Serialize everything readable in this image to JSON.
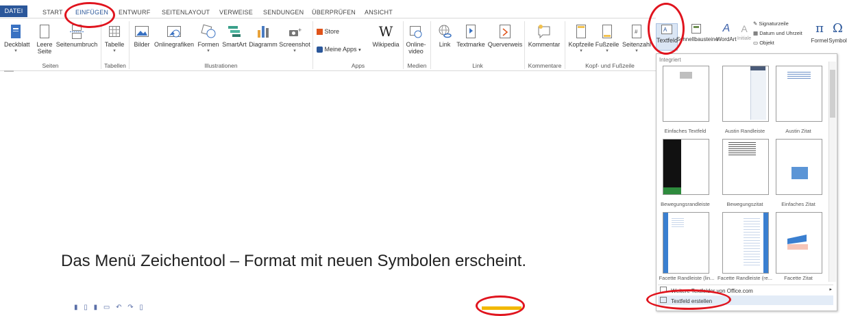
{
  "tabs": {
    "file": "DATEI",
    "start": "START",
    "insert": "EINFÜGEN",
    "design": "ENTWURF",
    "layout": "SEITENLAYOUT",
    "references": "VERWEISE",
    "mailings": "SENDUNGEN",
    "review": "ÜBERPRÜFEN",
    "view": "ANSICHT"
  },
  "ribbon": {
    "coverpage": "Deckblatt",
    "blank_page_1": "Leere",
    "blank_page_2": "Seite",
    "page_break": "Seitenumbruch",
    "table": "Tabelle",
    "pictures": "Bilder",
    "online_pictures": "Onlinegrafiken",
    "shapes": "Formen",
    "smartart": "SmartArt",
    "chart": "Diagramm",
    "screenshot": "Screenshot",
    "store": "Store",
    "my_apps": "Meine Apps",
    "wikipedia": "Wikipedia",
    "online_video_1": "Online-",
    "online_video_2": "video",
    "link": "Link",
    "bookmark": "Textmarke",
    "crossref": "Querverweis",
    "comment": "Kommentar",
    "header": "Kopfzeile",
    "footer": "Fußzeile",
    "page_number": "Seitenzahl",
    "textbox": "Textfeld",
    "quickparts": "Schnellbausteine",
    "wordart": "WordArt",
    "dropcap": "Initiale",
    "signature_line": "Signaturzeile",
    "date_time": "Datum und Uhrzeit",
    "object": "Objekt",
    "equation": "Formel",
    "symbol": "Symbol"
  },
  "groups": {
    "pages": "Seiten",
    "tables": "Tabellen",
    "illustrations": "Illustrationen",
    "apps": "Apps",
    "media": "Medien",
    "links": "Link",
    "comments": "Kommentare",
    "header_footer": "Kopf- und Fußzeile"
  },
  "gallery": {
    "heading": "Integriert",
    "items": [
      "Einfaches Textfeld",
      "Austin Randleiste",
      "Austin Zitat",
      "Bewegungsrandleiste",
      "Bewegungszitat",
      "Einfaches Zitat",
      "Facette Randleiste (lin...",
      "Facette Randleiste (re...",
      "Facette Zitat"
    ],
    "more_office": "Weitere Textfelder von Office.com",
    "draw_textbox": "Textfeld erstellen"
  },
  "caption": "Das Menü Zeichentool – Format mit neuen Symbolen erscheint.",
  "colors": {
    "accent": "#2b579a",
    "highlight_circle": "#e0141e"
  }
}
